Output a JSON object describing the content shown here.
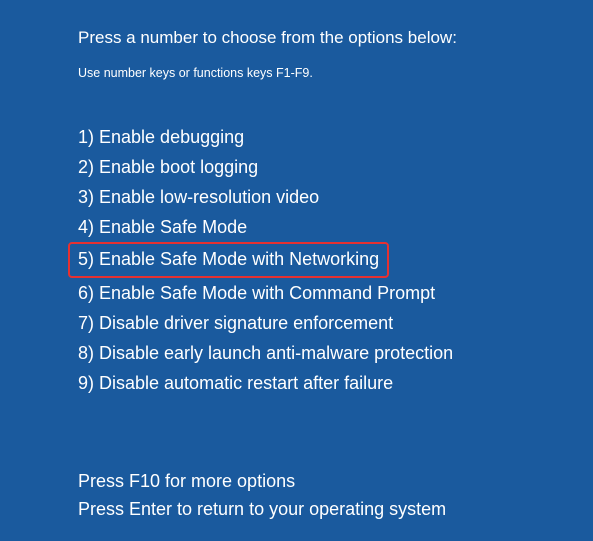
{
  "title": "Press a number to choose from the options below:",
  "subtitle": "Use number keys or functions keys F1-F9.",
  "options": [
    {
      "label": "1) Enable debugging",
      "highlighted": false
    },
    {
      "label": "2) Enable boot logging",
      "highlighted": false
    },
    {
      "label": "3) Enable low-resolution video",
      "highlighted": false
    },
    {
      "label": "4) Enable Safe Mode",
      "highlighted": false
    },
    {
      "label": "5) Enable Safe Mode with Networking",
      "highlighted": true
    },
    {
      "label": "6) Enable Safe Mode with Command Prompt",
      "highlighted": false
    },
    {
      "label": "7) Disable driver signature enforcement",
      "highlighted": false
    },
    {
      "label": "8) Disable early launch anti-malware protection",
      "highlighted": false
    },
    {
      "label": "9) Disable automatic restart after failure",
      "highlighted": false
    }
  ],
  "footer": {
    "line1": "Press F10 for more options",
    "line2": "Press Enter to return to your operating system"
  }
}
